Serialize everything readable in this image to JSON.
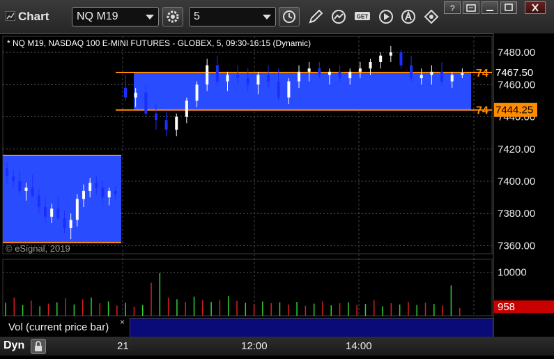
{
  "window": {
    "title": "Chart"
  },
  "toolbar": {
    "symbol": "NQ M19",
    "interval": "5",
    "buttons": [
      "settings-icon",
      "clock-icon",
      "pencil-icon",
      "studies-icon",
      "get-icon",
      "play-icon",
      "alert-icon",
      "link-icon"
    ]
  },
  "chart": {
    "description": "* NQ M19, NASDAQ 100 E-MINI FUTURES - GLOBEX, 5, 09:30-16:15 (Dynamic)",
    "copyright": "© eSignal, 2019",
    "price_axis_ticks": [
      "7480.00",
      "7460.00",
      "7440.00",
      "7420.00",
      "7400.00",
      "7380.00",
      "7360.00"
    ],
    "upper_level_label": "7467.50",
    "lower_level_label": "7444.25",
    "left_level_label_upper": "74",
    "left_level_label_lower": "74",
    "volume_axis_tick": "10000",
    "volume_current": "958",
    "time_labels": [
      "21",
      "12:00",
      "14:00"
    ],
    "volume_panel_label": "Vol (current price bar)",
    "volume_close": "×",
    "dyn_label": "Dyn",
    "colors": {
      "zone": "#2a4cff",
      "level": "#ff8c00",
      "up": "#ffffff",
      "down": "#1a2fff",
      "vol_up": "#2fd12f",
      "vol_down": "#d62020",
      "vol_badge": "#c80000"
    }
  },
  "chart_data": {
    "type": "candlestick",
    "title": "* NQ M19, NASDAQ 100 E-MINI FUTURES - GLOBEX, 5, 09:30-16:15 (Dynamic)",
    "y_axis_ticks": [
      7480,
      7460,
      7440,
      7420,
      7400,
      7380,
      7360
    ],
    "ylim": [
      7355,
      7490
    ],
    "zones": [
      {
        "from": 7444.25,
        "to": 7467.5,
        "session": "current"
      },
      {
        "from": 7362,
        "to": 7416,
        "session": "previous"
      }
    ],
    "x_labels": [
      "21",
      "12:00",
      "14:00"
    ],
    "volume_tick": 10000,
    "volume_current": 958,
    "candles": [
      [
        7408,
        7412,
        7398,
        7403
      ],
      [
        7403,
        7407,
        7396,
        7400
      ],
      [
        7400,
        7406,
        7392,
        7394
      ],
      [
        7394,
        7399,
        7388,
        7396
      ],
      [
        7396,
        7404,
        7390,
        7391
      ],
      [
        7391,
        7395,
        7380,
        7384
      ],
      [
        7384,
        7390,
        7374,
        7378
      ],
      [
        7378,
        7386,
        7374,
        7383
      ],
      [
        7383,
        7390,
        7376,
        7377
      ],
      [
        7377,
        7382,
        7368,
        7371
      ],
      [
        7371,
        7380,
        7364,
        7376
      ],
      [
        7376,
        7392,
        7372,
        7389
      ],
      [
        7389,
        7398,
        7384,
        7394
      ],
      [
        7394,
        7402,
        7390,
        7399
      ],
      [
        7399,
        7403,
        7392,
        7396
      ],
      [
        7396,
        7400,
        7386,
        7390
      ],
      [
        7390,
        7396,
        7385,
        7394
      ],
      [
        7394,
        7397,
        7388,
        7392
      ],
      [
        7458,
        7466,
        7450,
        7452
      ],
      [
        7452,
        7458,
        7446,
        7455
      ],
      [
        7455,
        7460,
        7440,
        7442
      ],
      [
        7442,
        7448,
        7432,
        7438
      ],
      [
        7438,
        7444,
        7428,
        7432
      ],
      [
        7432,
        7442,
        7428,
        7440
      ],
      [
        7440,
        7452,
        7436,
        7450
      ],
      [
        7450,
        7462,
        7446,
        7460
      ],
      [
        7460,
        7476,
        7456,
        7472
      ],
      [
        7472,
        7478,
        7460,
        7462
      ],
      [
        7462,
        7468,
        7456,
        7466
      ],
      [
        7466,
        7472,
        7460,
        7464
      ],
      [
        7464,
        7470,
        7456,
        7460
      ],
      [
        7460,
        7468,
        7454,
        7466
      ],
      [
        7466,
        7472,
        7458,
        7462
      ],
      [
        7462,
        7470,
        7450,
        7452
      ],
      [
        7452,
        7464,
        7448,
        7462
      ],
      [
        7462,
        7472,
        7458,
        7468
      ],
      [
        7468,
        7474,
        7462,
        7470
      ],
      [
        7470,
        7474,
        7464,
        7466
      ],
      [
        7466,
        7470,
        7460,
        7468
      ],
      [
        7468,
        7472,
        7462,
        7464
      ],
      [
        7464,
        7470,
        7460,
        7468
      ],
      [
        7468,
        7474,
        7464,
        7470
      ],
      [
        7470,
        7476,
        7466,
        7474
      ],
      [
        7474,
        7480,
        7470,
        7478
      ],
      [
        7478,
        7484,
        7474,
        7480
      ],
      [
        7480,
        7482,
        7470,
        7472
      ],
      [
        7472,
        7478,
        7462,
        7464
      ],
      [
        7464,
        7470,
        7460,
        7466
      ],
      [
        7466,
        7472,
        7460,
        7468
      ],
      [
        7468,
        7474,
        7460,
        7462
      ],
      [
        7462,
        7468,
        7458,
        7466
      ],
      [
        7466,
        7470,
        7464,
        7467
      ]
    ],
    "volumes": [
      [
        3000,
        "u"
      ],
      [
        4200,
        "d"
      ],
      [
        2500,
        "u"
      ],
      [
        3500,
        "d"
      ],
      [
        2200,
        "u"
      ],
      [
        2800,
        "d"
      ],
      [
        3100,
        "u"
      ],
      [
        4000,
        "d"
      ],
      [
        2600,
        "u"
      ],
      [
        3800,
        "d"
      ],
      [
        4200,
        "u"
      ],
      [
        2900,
        "d"
      ],
      [
        3300,
        "u"
      ],
      [
        2400,
        "d"
      ],
      [
        3000,
        "u"
      ],
      [
        2100,
        "d"
      ],
      [
        2500,
        "u"
      ],
      [
        7600,
        "d"
      ],
      [
        9800,
        "u"
      ],
      [
        4200,
        "d"
      ],
      [
        3800,
        "u"
      ],
      [
        3200,
        "d"
      ],
      [
        4400,
        "u"
      ],
      [
        3600,
        "d"
      ],
      [
        3200,
        "u"
      ],
      [
        3600,
        "d"
      ],
      [
        4500,
        "u"
      ],
      [
        3400,
        "d"
      ],
      [
        3000,
        "u"
      ],
      [
        2700,
        "d"
      ],
      [
        3300,
        "u"
      ],
      [
        2900,
        "d"
      ],
      [
        3100,
        "u"
      ],
      [
        2600,
        "d"
      ],
      [
        3200,
        "u"
      ],
      [
        2300,
        "d"
      ],
      [
        2800,
        "u"
      ],
      [
        3300,
        "d"
      ],
      [
        2400,
        "u"
      ],
      [
        2900,
        "d"
      ],
      [
        3100,
        "u"
      ],
      [
        2500,
        "d"
      ],
      [
        2700,
        "u"
      ],
      [
        3600,
        "d"
      ],
      [
        2200,
        "u"
      ],
      [
        2900,
        "d"
      ],
      [
        2600,
        "u"
      ],
      [
        3200,
        "d"
      ],
      [
        2500,
        "u"
      ],
      [
        3000,
        "d"
      ],
      [
        2700,
        "u"
      ],
      [
        2400,
        "d"
      ],
      [
        7000,
        "u"
      ],
      [
        1800,
        "d"
      ]
    ]
  }
}
